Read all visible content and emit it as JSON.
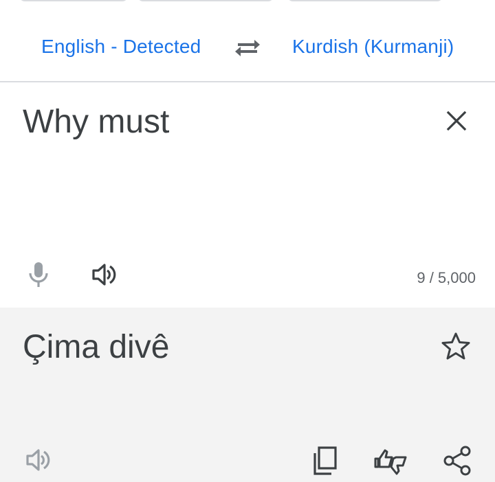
{
  "language_bar": {
    "source_language": "English - Detected",
    "target_language": "Kurdish (Kurmanji)",
    "swap_icon": "swap-arrows-icon"
  },
  "input": {
    "text": "Why must",
    "char_count": "9 / 5,000",
    "icons": [
      "close-icon",
      "microphone-icon",
      "speaker-icon"
    ]
  },
  "output": {
    "text": "Çima divê",
    "icons": [
      "star-icon",
      "speaker-icon",
      "copy-icon",
      "feedback-icon",
      "share-icon"
    ]
  },
  "colors": {
    "accent": "#1a73e8",
    "text": "#3c4043",
    "output_background": "#f3f3f3",
    "disabled_icon": "#9aa0a6"
  }
}
